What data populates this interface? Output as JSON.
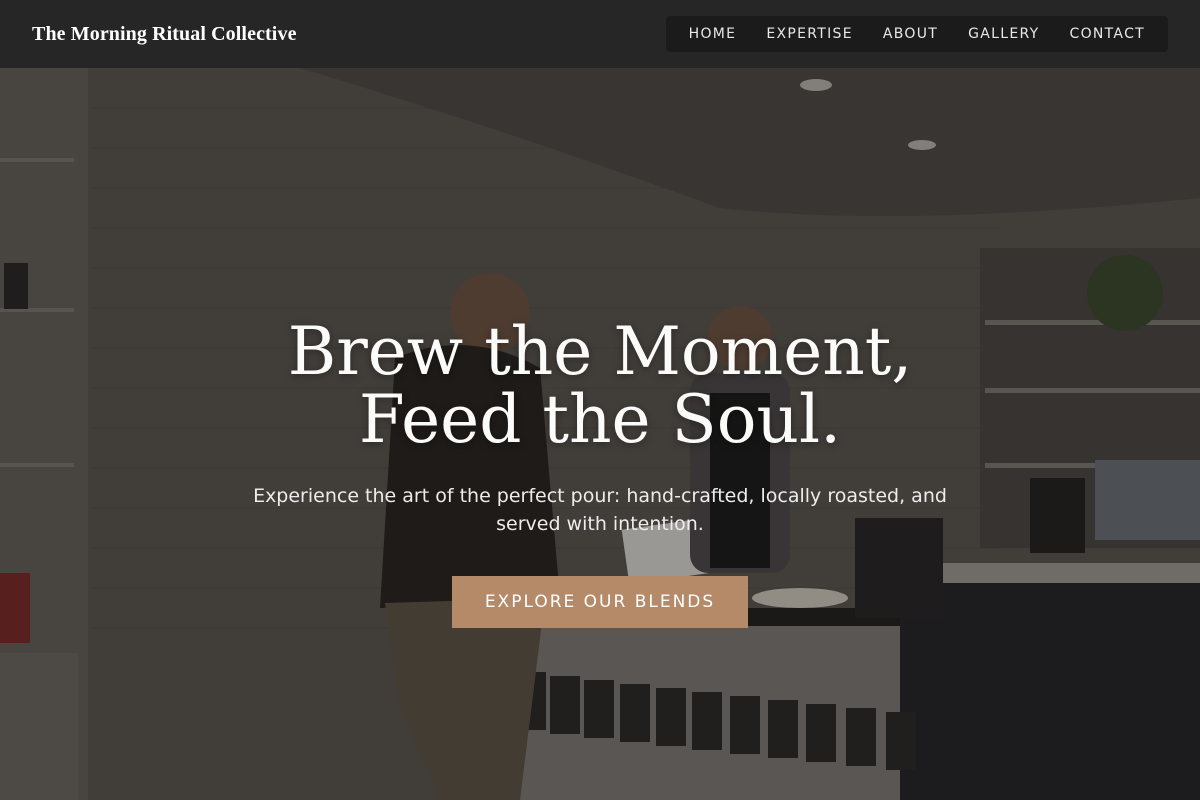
{
  "header": {
    "brand": "The Morning Ritual Collective",
    "nav": [
      {
        "label": "HOME"
      },
      {
        "label": "EXPERTISE"
      },
      {
        "label": "ABOUT"
      },
      {
        "label": "GALLERY"
      },
      {
        "label": "CONTACT"
      }
    ]
  },
  "hero": {
    "title": "Brew the Moment, Feed the Soul.",
    "subtitle": "Experience the art of the perfect pour: hand-crafted, locally roasted, and served with intention.",
    "cta_label": "EXPLORE OUR BLENDS",
    "background_image": "coffee-shop-counter-photo"
  },
  "colors": {
    "header_bg": "#262626",
    "nav_bg": "#1b1b1b",
    "accent": "#b58a68",
    "text": "#ffffff"
  }
}
